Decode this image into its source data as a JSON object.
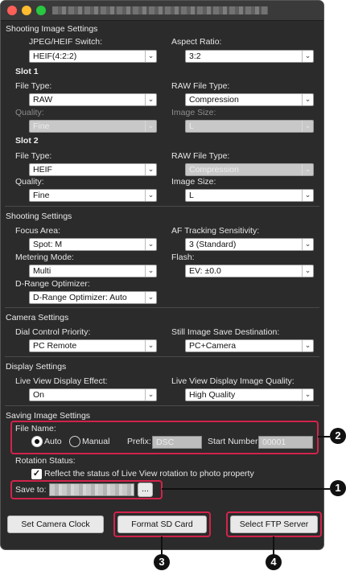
{
  "shooting_image": {
    "section_title": "Shooting Image Settings",
    "jpeg_heif_label": "JPEG/HEIF Switch:",
    "jpeg_heif_value": "HEIF(4:2:2)",
    "aspect_label": "Aspect Ratio:",
    "aspect_value": "3:2",
    "slot1": {
      "title": "Slot 1",
      "file_type_label": "File Type:",
      "file_type_value": "RAW",
      "raw_type_label": "RAW File Type:",
      "raw_type_value": "Compression",
      "quality_label": "Quality:",
      "quality_value": "Fine",
      "image_size_label": "Image Size:",
      "image_size_value": "L"
    },
    "slot2": {
      "title": "Slot 2",
      "file_type_label": "File Type:",
      "file_type_value": "HEIF",
      "raw_type_label": "RAW File Type:",
      "raw_type_value": "Compression",
      "quality_label": "Quality:",
      "quality_value": "Fine",
      "image_size_label": "Image Size:",
      "image_size_value": "L"
    }
  },
  "shooting": {
    "section_title": "Shooting Settings",
    "focus_label": "Focus Area:",
    "focus_value": "Spot: M",
    "af_label": "AF Tracking Sensitivity:",
    "af_value": "3 (Standard)",
    "metering_label": "Metering Mode:",
    "metering_value": "Multi",
    "flash_label": "Flash:",
    "flash_value": "EV: ±0.0",
    "dro_label": "D-Range Optimizer:",
    "dro_value": "D-Range Optimizer: Auto"
  },
  "camera": {
    "section_title": "Camera Settings",
    "dial_label": "Dial Control Priority:",
    "dial_value": "PC Remote",
    "save_dest_label": "Still Image Save Destination:",
    "save_dest_value": "PC+Camera"
  },
  "display": {
    "section_title": "Display Settings",
    "lv_effect_label": "Live View Display Effect:",
    "lv_effect_value": "On",
    "lv_quality_label": "Live View Display Image Quality:",
    "lv_quality_value": "High Quality"
  },
  "saving": {
    "section_title": "Saving Image Settings",
    "file_name_label": "File Name:",
    "auto_label": "Auto",
    "manual_label": "Manual",
    "prefix_label": "Prefix:",
    "prefix_value": "DSC",
    "start_number_label": "Start Number:",
    "start_number_value": "00001",
    "rotation_label": "Rotation Status:",
    "rotation_checkbox_label": "Reflect the status of Live View rotation to photo property",
    "save_to_label": "Save to:",
    "browse_label": "..."
  },
  "buttons": {
    "set_clock": "Set Camera Clock",
    "format_sd": "Format SD Card",
    "select_ftp": "Select FTP Server"
  },
  "callouts": {
    "c1": "1",
    "c2": "2",
    "c3": "3",
    "c4": "4"
  },
  "colors": {
    "highlight": "#d2234b",
    "window_bg": "#2b2b2b"
  }
}
